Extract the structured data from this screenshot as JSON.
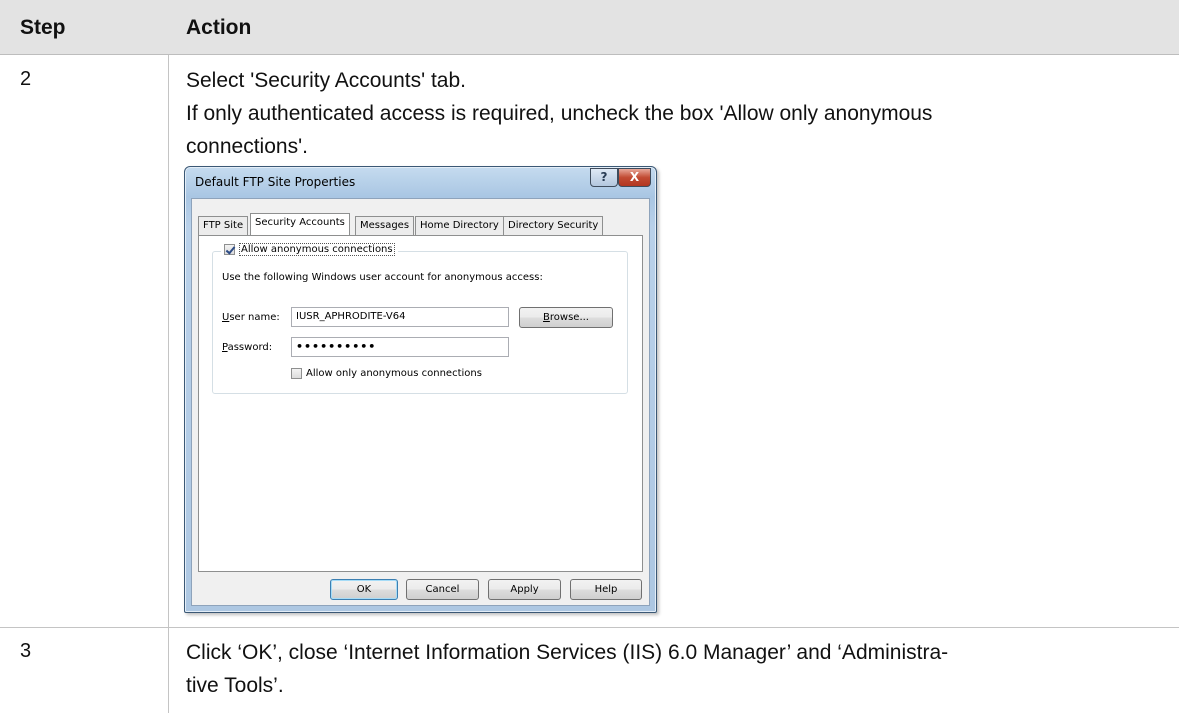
{
  "table": {
    "header": {
      "step": "Step",
      "action": "Action"
    },
    "rows": [
      {
        "step": "2",
        "lines": [
          "Select 'Security Accounts' tab.",
          "If only authenticated access is required, uncheck the box 'Allow only anonymous",
          "connections'."
        ]
      },
      {
        "step": "3",
        "lines": [
          "Click ‘OK’, close ‘Internet Information Services (IIS) 6.0 Manager’ and ‘Administra-",
          "tive Tools’."
        ]
      }
    ]
  },
  "dialog": {
    "title": "Default FTP Site Properties",
    "help_glyph": "?",
    "close_glyph": "X",
    "tabs": [
      "FTP Site",
      "Security Accounts",
      "Messages",
      "Home Directory",
      "Directory Security"
    ],
    "active_tab": "Security Accounts",
    "allow_anonymous": {
      "label": "Allow anonymous connections",
      "checked": true
    },
    "description": "Use the following Windows user account for anonymous access:",
    "user_name": {
      "label_prefix": "U",
      "label_rest": "ser name:",
      "value": "IUSR_APHRODITE-V64"
    },
    "browse": {
      "prefix": "B",
      "rest": "rowse..."
    },
    "password": {
      "label_prefix": "P",
      "label_rest": "assword:",
      "value": "••••••••••"
    },
    "allow_only_anonymous": {
      "label": "Allow only anonymous connections",
      "checked": false
    },
    "buttons": {
      "ok": "OK",
      "cancel": "Cancel",
      "apply": "Apply",
      "help": "Help"
    }
  }
}
